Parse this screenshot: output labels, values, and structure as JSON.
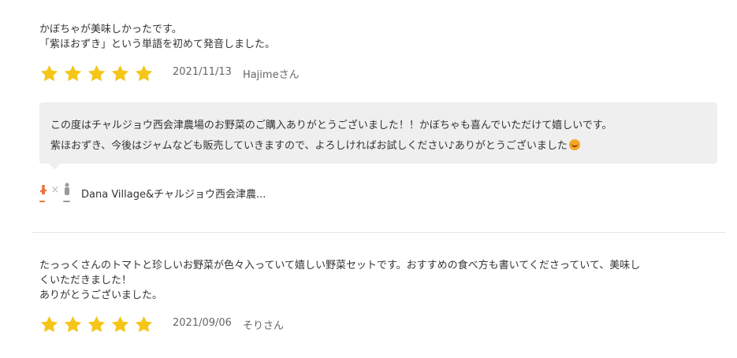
{
  "reviews": [
    {
      "text": "かぼちゃが美味しかったです。\n「紫ほおずき」という単語を初めて発音しました。",
      "rating": 5,
      "date": "2021/11/13",
      "author": "Hajimeさん"
    },
    {
      "text": "たっっくさんのトマトと珍しいお野菜が色々入っていて嬉しい野菜セットです。おすすめの食べ方も書いてくださっていて、美味し\nくいただきました！\nありがとうございました。",
      "rating": 5,
      "date": "2021/09/06",
      "author": "そりさん"
    }
  ],
  "reply": {
    "line1": "この度はチャルジョウ西会津農場のお野菜のご購入ありがとうございました！！かぼちゃも喜んでいただけて嬉しいです。",
    "line2": "紫ほおずき、今後はジャムなども販売していきますので、よろしければお試しください♪ありがとうございました",
    "emoji_icon": "smiling-face-icon",
    "shop_name": "Dana Village&チャルジョウ西会津農...",
    "logo_separator": "×"
  },
  "colors": {
    "star": "#f5c518",
    "reply_background": "#efefef",
    "text": "#333333",
    "meta": "#666666",
    "divider": "#e6e6e6"
  }
}
